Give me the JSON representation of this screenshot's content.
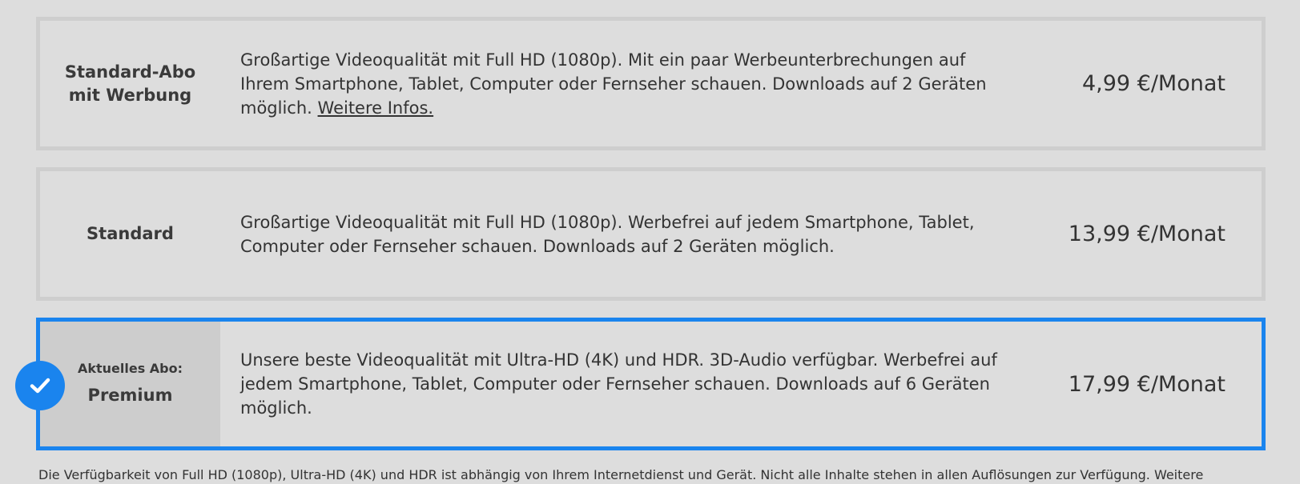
{
  "plans": [
    {
      "name": "Standard-Abo\nmit Werbung",
      "description": "Großartige Videoqualität mit Full HD (1080p). Mit ein paar Werbeunterbrechungen auf Ihrem Smartphone, Tablet, Computer oder Fernseher schauen. Downloads auf 2 Geräten möglich.",
      "link_label": "Weitere Infos.",
      "price": "4,99 €/Monat"
    },
    {
      "name": "Standard",
      "description": "Großartige Videoqualität mit Full HD (1080p). Werbefrei auf jedem Smartphone, Tablet, Computer oder Fernseher schauen. Downloads auf 2 Geräten möglich.",
      "price": "13,99 €/Monat"
    },
    {
      "current_label": "Aktuelles Abo:",
      "name": "Premium",
      "description": "Unsere beste Videoqualität mit Ultra-HD (4K) und HDR. 3D-Audio verfügbar. Werbefrei auf jedem Smartphone, Tablet, Computer oder Fernseher schauen. Downloads auf 6 Geräten möglich.",
      "price": "17,99 €/Monat",
      "selected": true
    }
  ],
  "footnote": "Die Verfügbarkeit von Full HD (1080p), Ultra-HD (4K) und HDR ist abhängig von Ihrem Internetdienst und Gerät. Nicht alle Inhalte stehen in allen Auflösungen zur Verfügung. Weitere",
  "icons": {
    "selected_check": "check-icon"
  },
  "colors": {
    "background": "#dddddd",
    "card_border": "#cecece",
    "selected_border": "#1a84ee",
    "selected_name_cell": "#cdcdcd",
    "text": "#333333"
  }
}
